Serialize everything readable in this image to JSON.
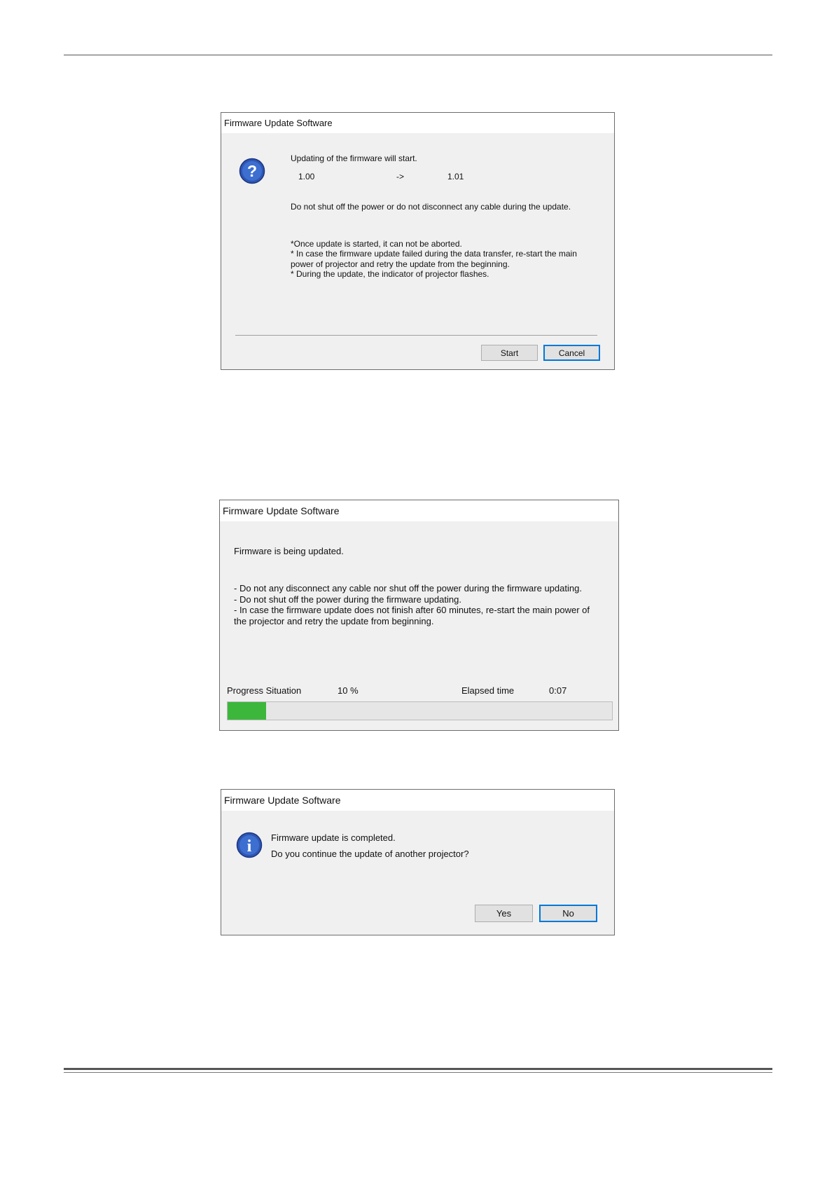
{
  "dialog1": {
    "title": "Firmware Update Software",
    "heading": "Updating of the firmware will start.",
    "version_from": "1.00",
    "arrow": "->",
    "version_to": "1.01",
    "warning": "Do not shut off the power or do not disconnect any cable during the update.",
    "notes": [
      "*Once update is started, it can not be aborted.",
      "* In case the firmware update failed during the data transfer, re-start the main",
      "power of projector and retry the update from the beginning.",
      "* During the update, the indicator of projector flashes."
    ],
    "start_label": "Start",
    "cancel_label": "Cancel",
    "icon": "question-icon"
  },
  "dialog2": {
    "title": "Firmware Update Software",
    "heading": "Firmware is being updated.",
    "notes": [
      "- Do not any disconnect any cable nor shut off the power during the firmware updating.",
      "- Do not shut off the power during the firmware updating.",
      "- In case the firmware update does not finish after 60 minutes, re-start the main power of",
      "the projector and retry the update from beginning."
    ],
    "progress_label": "Progress Situation",
    "progress_value": "10 %",
    "progress_fraction": 0.1,
    "elapsed_label": "Elapsed time",
    "elapsed_value": "0:07",
    "progress_color": "#3cb73c"
  },
  "dialog3": {
    "title": "Firmware Update Software",
    "message_line1": "Firmware update is completed.",
    "message_line2": "Do you continue the update of another projector?",
    "yes_label": "Yes",
    "no_label": "No",
    "icon": "info-icon"
  },
  "colors": {
    "accent": "#0078d7",
    "dialog_bg": "#f0f0f0"
  }
}
